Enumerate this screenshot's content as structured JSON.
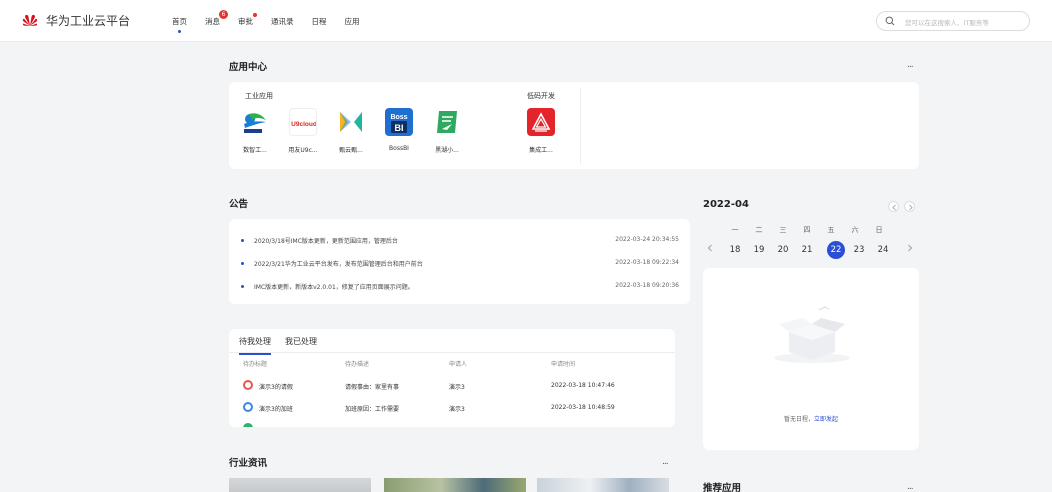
{
  "header": {
    "brand": "华为工业云平台",
    "nav": [
      {
        "label": "首页",
        "active": true
      },
      {
        "label": "消息",
        "badge": "6"
      },
      {
        "label": "审批",
        "dot": true
      },
      {
        "label": "通讯录"
      },
      {
        "label": "日程"
      },
      {
        "label": "应用"
      }
    ],
    "search_placeholder": "您可以在这搜索人、IT服务等"
  },
  "app_center": {
    "title": "应用中心",
    "more": "...",
    "groups": [
      {
        "title": "工业应用",
        "apps": [
          {
            "name": "数智工...",
            "icon": "industrial-logo-icon"
          },
          {
            "name": "用友U9c...",
            "icon": "u9cloud-logo-icon",
            "icon_text": "U9cloud"
          },
          {
            "name": "甄云甄...",
            "icon": "zhenyun-logo-icon"
          },
          {
            "name": "BossBI",
            "icon": "bossbi-logo-icon",
            "icon_text": "Boss BI"
          },
          {
            "name": "黑湖小...",
            "icon": "heihu-logo-icon"
          }
        ]
      },
      {
        "title": "低码开发",
        "apps": [
          {
            "name": "集成工...",
            "icon": "integration-logo-icon"
          }
        ]
      }
    ]
  },
  "announcements": {
    "title": "公告",
    "items": [
      {
        "text": "2020/3/18号IMC版本更新，更新范围应用，管理后台",
        "time": "2022-03-24 20:34:55"
      },
      {
        "text": "2022/3/21华为工业云平台发布，发布范围管理后台和用户前台",
        "time": "2022-03-18 09:22:34"
      },
      {
        "text": "IMC版本更新，新版本v2.0.01，修复了应用页面展示问题。",
        "time": "2022-03-18 09:20:36"
      }
    ]
  },
  "todo": {
    "tabs": [
      "待我处理",
      "我已处理"
    ],
    "headers": [
      "待办标题",
      "待办描述",
      "申请人",
      "申请时间"
    ],
    "rows": [
      {
        "title": "演示3的请假",
        "desc": "请假事由：家里有事",
        "applicant": "演示3",
        "time": "2022-03-18 10:47:46",
        "color": "#e9554a"
      },
      {
        "title": "演示3的加班",
        "desc": "加班原因：工作需要",
        "applicant": "演示3",
        "time": "2022-03-18 10:48:59",
        "color": "#3c86e0"
      }
    ]
  },
  "news": {
    "title": "行业资讯",
    "more": "..."
  },
  "calendar": {
    "title": "2022-04",
    "weekdays": [
      "一",
      "二",
      "三",
      "四",
      "五",
      "六",
      "日"
    ],
    "days": [
      "18",
      "19",
      "20",
      "21",
      "22",
      "23",
      "24"
    ],
    "selected": "22",
    "empty_text": "暂无日程，",
    "empty_link": "立即发起"
  },
  "recommended": {
    "title": "推荐应用",
    "more": "..."
  },
  "colors": {
    "accent": "#2a4fd6",
    "badge": "#e5332a",
    "bg": "#f3f4f6"
  }
}
